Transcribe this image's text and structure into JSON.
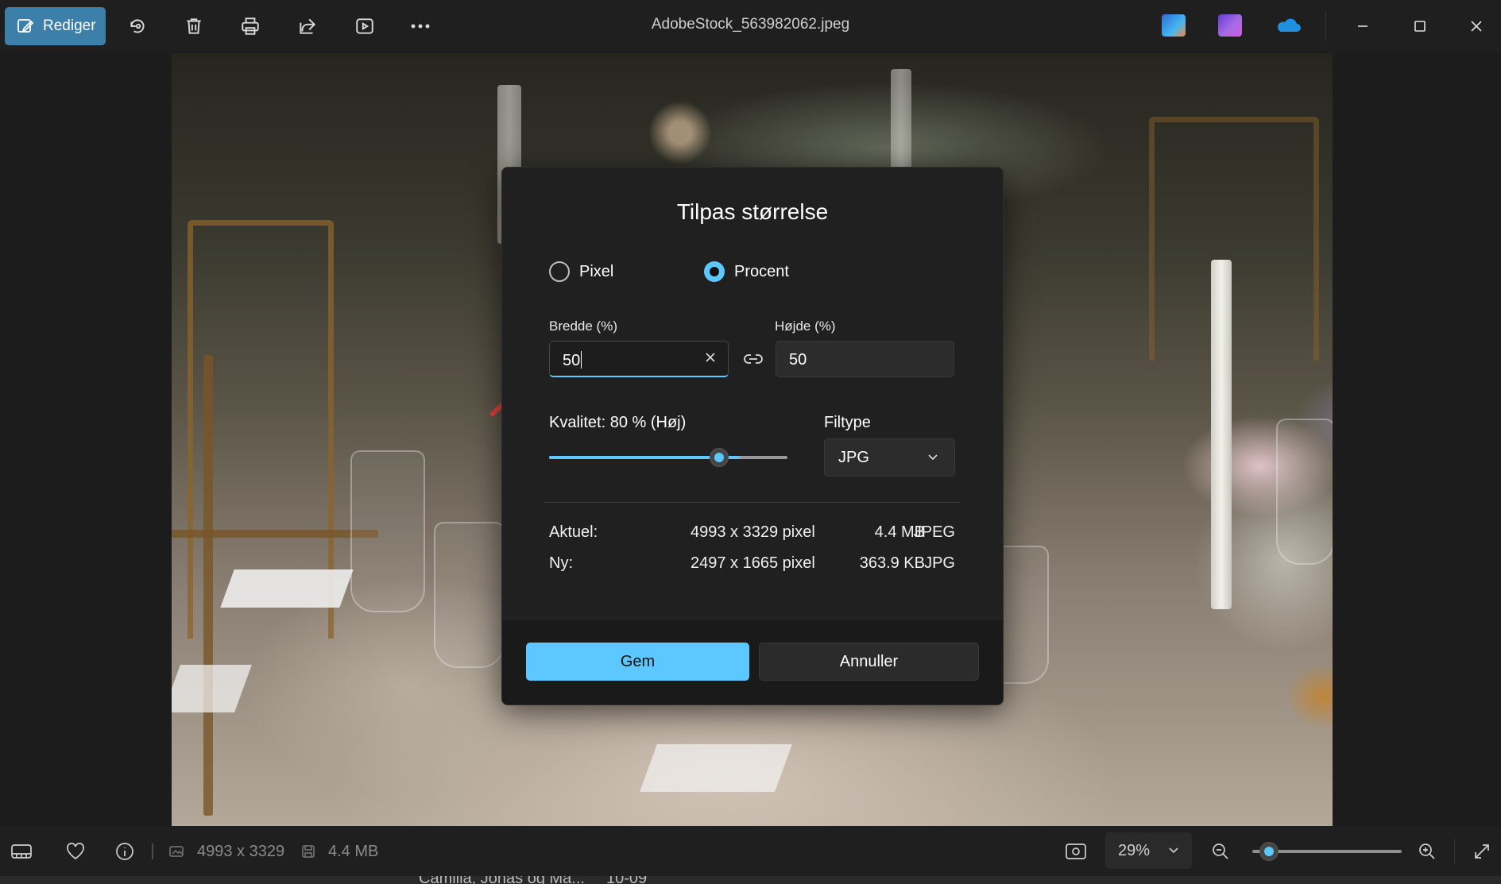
{
  "toolbar": {
    "edit_label": "Rediger",
    "icons": [
      "edit-icon",
      "rotate-icon",
      "delete-icon",
      "print-icon",
      "share-icon",
      "slideshow-icon",
      "more-icon"
    ],
    "file_title": "AdobeStock_563982062.jpeg",
    "apps": [
      "designer-app-icon",
      "clipchamp-app-icon",
      "onedrive-app-icon"
    ],
    "window_controls": [
      "minimize-icon",
      "maximize-icon",
      "close-icon"
    ]
  },
  "dialog": {
    "title": "Tilpas størrelse",
    "mode_options": [
      {
        "label": "Pixel",
        "selected": false
      },
      {
        "label": "Procent",
        "selected": true
      }
    ],
    "width": {
      "label": "Bredde  (%)",
      "value": "50"
    },
    "height": {
      "label": "Højde  (%)",
      "value": "50"
    },
    "quality_label": "Kvalitet: 80 % (Høj)",
    "quality_value": 80,
    "filetype_label": "Filtype",
    "filetype_value": "JPG",
    "current": {
      "label": "Aktuel:",
      "dimensions": "4993 x 3329 pixel",
      "size": "4.4 MB",
      "format": "JPEG"
    },
    "new": {
      "label": "Ny:",
      "dimensions": "2497 x 1665 pixel",
      "size": "363.9 KB",
      "format": "JPG"
    },
    "save_label": "Gem",
    "cancel_label": "Annuller"
  },
  "bottombar": {
    "dimensions": "4993 x 3329",
    "filesize": "4.4 MB",
    "zoom": "29%",
    "zoom_level": 0.05
  },
  "filmstrip": {
    "item_label": "Camilla, Jonas og Ma...",
    "item_date": "10-09"
  },
  "colors": {
    "accent": "#5cc8ff",
    "edit_button": "#3c7fa8",
    "annotation_arrow": "#e8413c"
  }
}
